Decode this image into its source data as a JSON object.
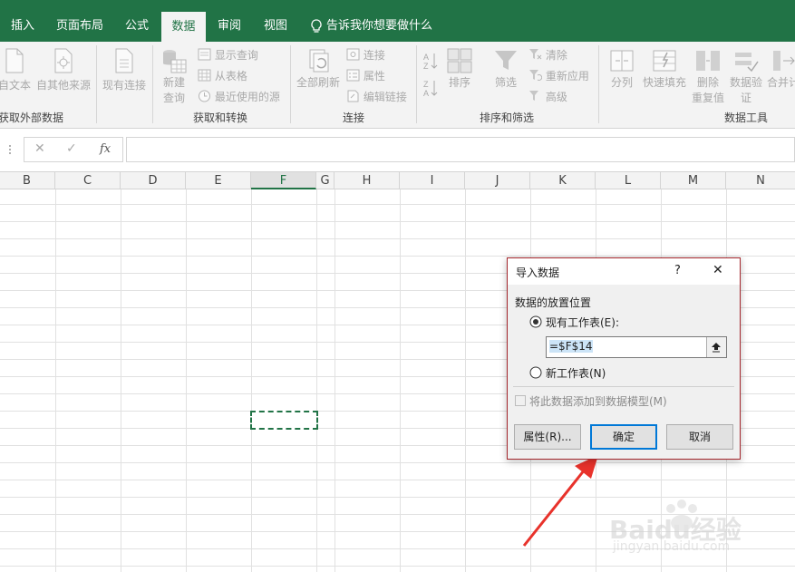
{
  "ribbon_tabs": [
    {
      "label": "插入",
      "active": false
    },
    {
      "label": "页面布局",
      "active": false
    },
    {
      "label": "公式",
      "active": false
    },
    {
      "label": "数据",
      "active": true
    },
    {
      "label": "审阅",
      "active": false
    },
    {
      "label": "视图",
      "active": false
    }
  ],
  "tell_me": "告诉我你想要做什么",
  "groups": {
    "external": {
      "label": "获取外部数据",
      "text_btn": "自文本",
      "other_btn": "自其他来源",
      "existing_btn": "现有连接"
    },
    "transform": {
      "label": "获取和转换",
      "new_query_line1": "新建",
      "new_query_line2": "查询",
      "show_queries": "显示查询",
      "from_table": "从表格",
      "recent_sources": "最近使用的源"
    },
    "connections": {
      "label": "连接",
      "refresh_all": "全部刷新",
      "connections": "连接",
      "properties": "属性",
      "edit_links": "编辑链接"
    },
    "sort_filter": {
      "label": "排序和筛选",
      "sort": "排序",
      "filter": "筛选",
      "clear": "清除",
      "reapply": "重新应用",
      "advanced": "高级"
    },
    "data_tools": {
      "label": "数据工具",
      "split": "分列",
      "flash_fill": "快速填充",
      "remove_dup_line1": "删除",
      "remove_dup_line2": "重复值",
      "validation_line1": "数据验",
      "validation_line2": "证",
      "consolidate": "合并计"
    }
  },
  "formula_bar": {
    "fx": "fx",
    "value": ""
  },
  "columns": [
    "B",
    "C",
    "D",
    "E",
    "F",
    "G",
    "H",
    "I",
    "J",
    "K",
    "L",
    "M",
    "N"
  ],
  "selected_column": "F",
  "dialog": {
    "title": "导入数据",
    "help": "?",
    "close": "✕",
    "section_label": "数据的放置位置",
    "option_existing": "现有工作表(E):",
    "option_existing_selected": true,
    "range_value": "=$F$14",
    "option_new": "新工作表(N)",
    "add_to_model": "将此数据添加到数据模型(M)",
    "add_to_model_checked": false,
    "btn_properties": "属性(R)...",
    "btn_ok": "确定",
    "btn_cancel": "取消"
  },
  "watermark": {
    "brand": "Baidu经验",
    "url": "jingyan.baidu.com"
  },
  "colors": {
    "excel_green": "#217346",
    "dialog_border": "#a4262c",
    "arrow": "#e8322b"
  }
}
